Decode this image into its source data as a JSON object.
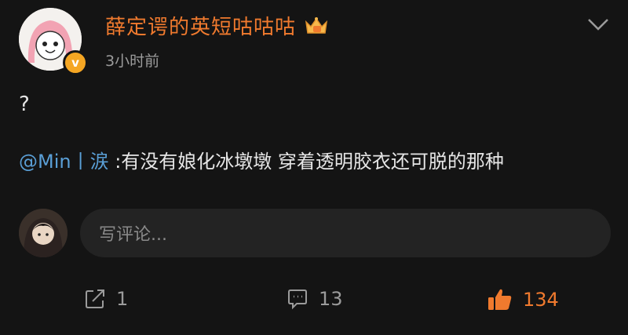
{
  "post": {
    "username": "薛定谔的英短咕咕咕",
    "timestamp": "3小时前",
    "text": "?",
    "quote": {
      "mention": "@Min丨涙",
      "body": " :有没有娘化冰墩墩 穿着透明胶衣还可脱的那种"
    }
  },
  "comment_box": {
    "placeholder": "写评论..."
  },
  "actions": {
    "repost_count": "1",
    "comment_count": "13",
    "like_count": "134"
  },
  "icons": {
    "verified": "verified-badge-icon",
    "crown": "crown-icon",
    "chevron": "chevron-down-icon",
    "repost": "share-icon",
    "comment": "comment-icon",
    "like": "thumbs-up-icon"
  },
  "colors": {
    "background": "#141414",
    "accent": "#f07a2e",
    "mention": "#5a9fd6",
    "muted": "#9b9b9b"
  }
}
